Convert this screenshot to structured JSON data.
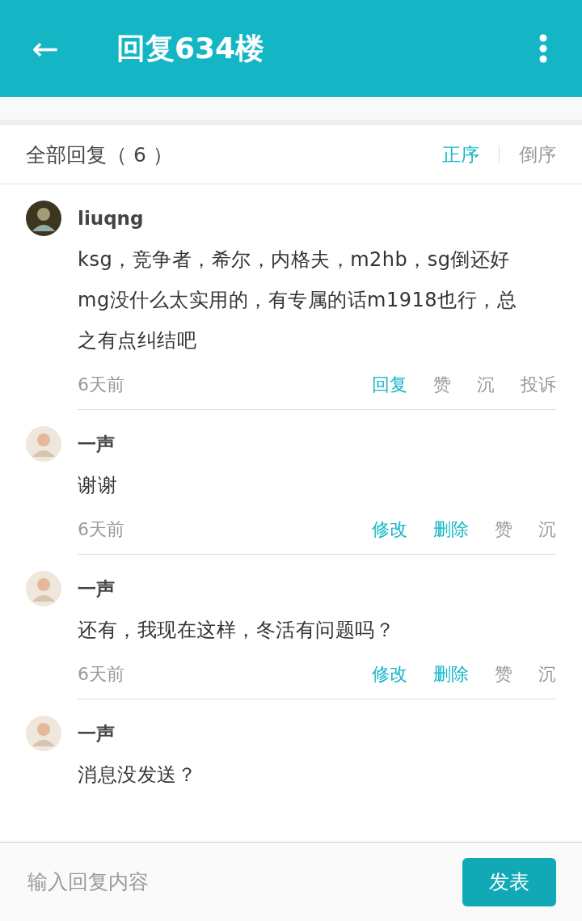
{
  "app_bar": {
    "back_icon": "←",
    "title": "回复634楼"
  },
  "replies_header": {
    "title": "全部回复（ 6 ）",
    "sort_tabs": [
      {
        "label": "正序",
        "selected": true
      },
      {
        "label": "倒序",
        "selected": false
      }
    ]
  },
  "comments": [
    {
      "user": "liuqng",
      "text": "ksg，竞争者，希尔，内格夫，m2hb，sg倒还好mg没什么太实用的，有专属的话m1918也行，总之有点纠结吧",
      "time": "6天前",
      "actions": [
        {
          "label": "回复",
          "highlighted": true
        },
        {
          "label": "赞",
          "highlighted": false
        },
        {
          "label": "沉",
          "highlighted": false
        },
        {
          "label": "投诉",
          "highlighted": false
        }
      ]
    },
    {
      "user": "一声",
      "text": "谢谢",
      "time": "6天前",
      "actions": [
        {
          "label": "修改",
          "highlighted": true
        },
        {
          "label": "删除",
          "highlighted": true
        },
        {
          "label": "赞",
          "highlighted": false
        },
        {
          "label": "沉",
          "highlighted": false
        }
      ]
    },
    {
      "user": "一声",
      "text": "还有，我现在这样，冬活有问题吗？",
      "time": "6天前",
      "actions": [
        {
          "label": "修改",
          "highlighted": true
        },
        {
          "label": "删除",
          "highlighted": true
        },
        {
          "label": "赞",
          "highlighted": false
        },
        {
          "label": "沉",
          "highlighted": false
        }
      ]
    },
    {
      "user": "一声",
      "text": "消息没发送？"
    }
  ],
  "composer": {
    "placeholder": "输入回复内容",
    "send_button": "发表"
  }
}
